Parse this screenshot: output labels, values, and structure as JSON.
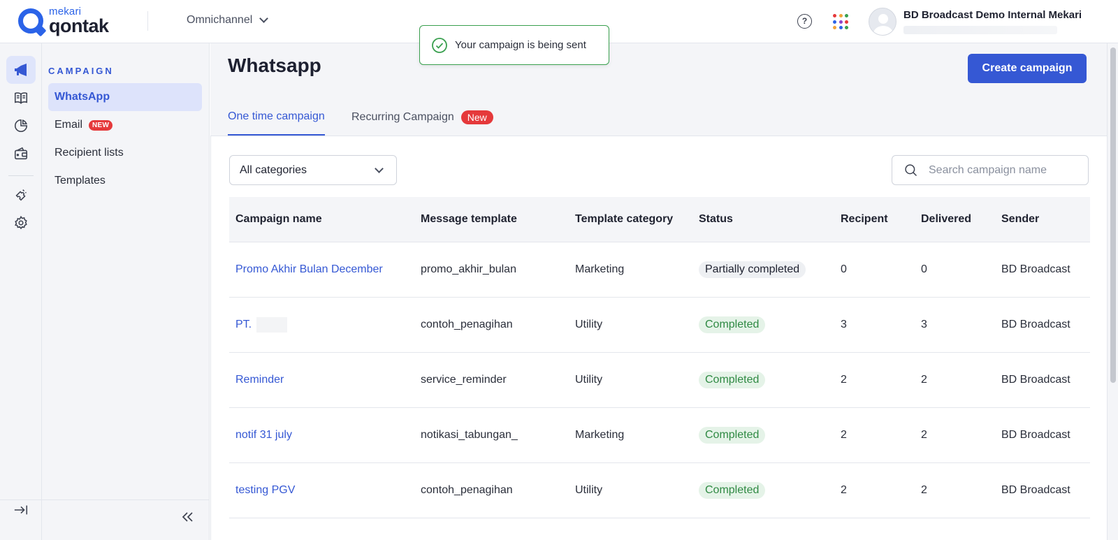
{
  "brand": {
    "small": "mekari",
    "big": "qontak",
    "color": "#2b63e8"
  },
  "header": {
    "workspace": "Omnichannel",
    "user_name": "BD Broadcast Demo Internal Mekari",
    "icons": [
      "help-icon",
      "apps-grid-icon",
      "avatar"
    ]
  },
  "toast": {
    "message": "Your campaign is being sent",
    "color": "#3aa04f"
  },
  "rail": {
    "items": [
      "megaphone-icon",
      "book-icon",
      "pie-chart-icon",
      "wallet-icon",
      "puzzle-icon",
      "gear-icon"
    ],
    "expand_icon": "expand-arrow-icon"
  },
  "subnav": {
    "section_title": "CAMPAIGN",
    "items": [
      {
        "label": "WhatsApp",
        "active": true
      },
      {
        "label": "Email",
        "badge": "NEW"
      },
      {
        "label": "Recipient lists"
      },
      {
        "label": "Templates"
      }
    ]
  },
  "main": {
    "title": "Whatsapp",
    "create_button": "Create campaign",
    "tabs": [
      {
        "label": "One time campaign",
        "active": true
      },
      {
        "label": "Recurring Campaign",
        "badge": "New"
      }
    ],
    "filter": {
      "selected": "All categories"
    },
    "search": {
      "placeholder": "Search campaign name"
    },
    "table": {
      "columns": [
        "Campaign name",
        "Message template",
        "Template category",
        "Status",
        "Recipent",
        "Delivered",
        "Sender"
      ],
      "rows": [
        {
          "name": "Promo Akhir Bulan December",
          "template": "promo_akhir_bulan",
          "category": "Marketing",
          "status": "Partially completed",
          "recipient": "0",
          "delivered": "0",
          "sender": "BD Broadcast"
        },
        {
          "name": "PT. ",
          "template": "contoh_penagihan",
          "category": "Utility",
          "status": "Completed",
          "recipient": "3",
          "delivered": "3",
          "sender": "BD Broadcast"
        },
        {
          "name": "Reminder",
          "template": "service_reminder",
          "category": "Utility",
          "status": "Completed",
          "recipient": "2",
          "delivered": "2",
          "sender": "BD Broadcast"
        },
        {
          "name": "notif 31 july",
          "template": "notikasi_tabungan_",
          "category": "Marketing",
          "status": "Completed",
          "recipient": "2",
          "delivered": "2",
          "sender": "BD Broadcast"
        },
        {
          "name": "testing PGV",
          "template": "contoh_penagihan",
          "category": "Utility",
          "status": "Completed",
          "recipient": "2",
          "delivered": "2",
          "sender": "BD Broadcast"
        }
      ]
    }
  },
  "colors": {
    "accent": "#3558d4",
    "danger": "#e5393b",
    "success": "#2f8a43"
  }
}
